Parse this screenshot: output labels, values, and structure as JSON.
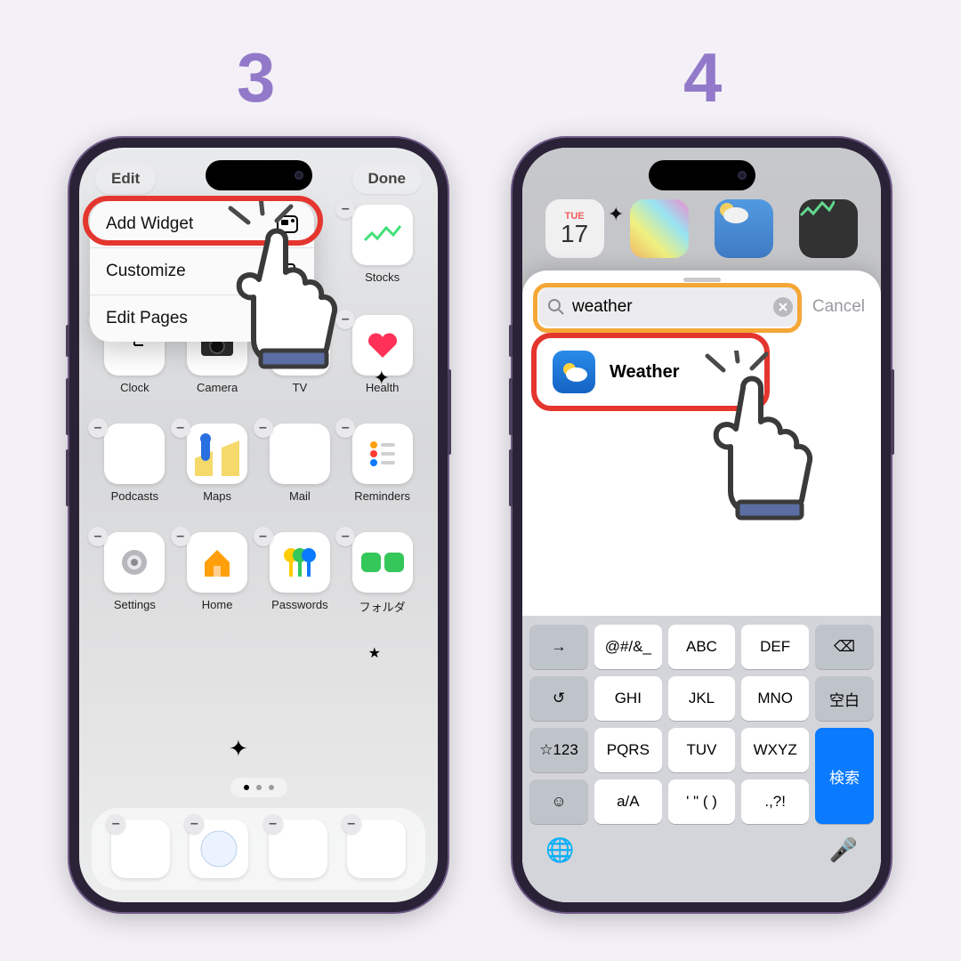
{
  "steps": {
    "left": "3",
    "right": "4"
  },
  "screen3": {
    "topbar": {
      "edit": "Edit",
      "done": "Done"
    },
    "menu": {
      "add_widget": "Add Widget",
      "customize": "Customize",
      "edit_pages": "Edit Pages"
    },
    "apps_row1": [
      {
        "name": "stocks",
        "label": "Stocks"
      }
    ],
    "apps_row2": [
      {
        "name": "clock",
        "label": "Clock"
      },
      {
        "name": "camera",
        "label": "Camera"
      },
      {
        "name": "tv",
        "label": "TV"
      },
      {
        "name": "health",
        "label": "Health"
      }
    ],
    "apps_row3": [
      {
        "name": "podcasts",
        "label": "Podcasts"
      },
      {
        "name": "maps",
        "label": "Maps"
      },
      {
        "name": "mail",
        "label": "Mail"
      },
      {
        "name": "reminders",
        "label": "Reminders"
      }
    ],
    "apps_row4": [
      {
        "name": "settings",
        "label": "Settings"
      },
      {
        "name": "home",
        "label": "Home"
      },
      {
        "name": "passwords",
        "label": "Passwords"
      },
      {
        "name": "folder",
        "label": "フォルダ"
      }
    ],
    "dock": [
      {
        "name": "appstore"
      },
      {
        "name": "safari"
      },
      {
        "name": "phone"
      },
      {
        "name": "music"
      }
    ]
  },
  "screen4": {
    "calendar": {
      "day": "TUE",
      "date": "17"
    },
    "search": {
      "query": "weather",
      "cancel": "Cancel"
    },
    "result": {
      "label": "Weather"
    },
    "keyboard": {
      "row1": [
        "→",
        "@#/&_",
        "ABC",
        "DEF",
        "⌫"
      ],
      "row2": [
        "↺",
        "GHI",
        "JKL",
        "MNO",
        "空白"
      ],
      "row3": [
        "☆123",
        "PQRS",
        "TUV",
        "WXYZ"
      ],
      "search_key": "検索",
      "row4": [
        "☺",
        "a/A",
        "' \" ( )",
        ".,?!"
      ],
      "globe": "🌐",
      "mic": "🎤"
    }
  }
}
